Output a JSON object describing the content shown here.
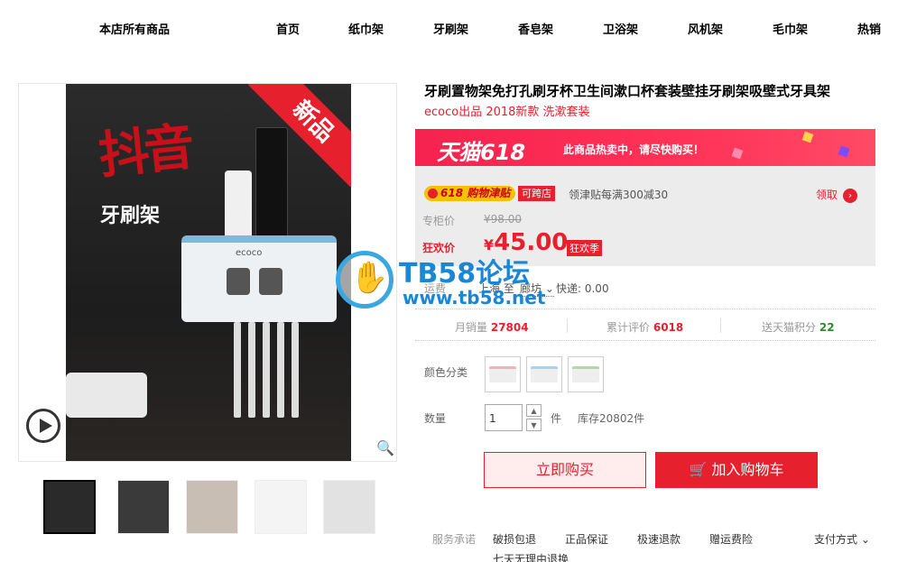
{
  "nav": {
    "store_all": "本店所有商品",
    "items": [
      "首页",
      "纸巾架",
      "牙刷架",
      "香皂架",
      "卫浴架",
      "风机架",
      "毛巾架",
      "热销"
    ]
  },
  "gallery": {
    "badge_new": "新品",
    "overlay_title": "抖音",
    "overlay_subtitle": "牙刷架",
    "holder_logo": "ecoco",
    "thumb_count": 5
  },
  "product": {
    "title": "牙刷置物架免打孔刷牙杯卫生间漱口杯套装壁挂牙刷架吸壁式牙具架",
    "subtitle": "ecoco出品 2018新款 洗漱套装"
  },
  "promo": {
    "banner_brand": "天猫618",
    "banner_text": "此商品热卖中，请尽快购买！",
    "coupon_tag": "618 购物津贴",
    "coupon_label": "可跨店",
    "coupon_desc": "领津贴每满300减30",
    "coupon_get": "领取"
  },
  "price": {
    "orig_label": "专柜价",
    "orig_value": "¥98.00",
    "sale_label": "狂欢价",
    "currency": "¥",
    "sale_value": "45.00",
    "sale_badge": "狂欢季"
  },
  "shipping": {
    "label": "运费",
    "from": "上海 至",
    "to": "廊坊",
    "fee": "快递: 0.00"
  },
  "stats": {
    "sales_label": "月销量",
    "sales_value": "27804",
    "reviews_label": "累计评价",
    "reviews_value": "6018",
    "points_label": "送天猫积分",
    "points_value": "22"
  },
  "options": {
    "color_label": "颜色分类",
    "swatch_colors": [
      "#e8b7b7",
      "#a9d3e6",
      "#b6d6a8"
    ],
    "qty_label": "数量",
    "qty_value": "1",
    "qty_unit": "件",
    "stock": "库存20802件"
  },
  "actions": {
    "buy_now": "立即购买",
    "add_cart": "加入购物车"
  },
  "service": {
    "label": "服务承诺",
    "items": [
      "破损包退",
      "正品保证",
      "极速退款",
      "赠运费险"
    ],
    "pay": "支付方式",
    "seven_day": "七天无理由退换"
  },
  "watermark": {
    "title": "TB58论坛",
    "url": "www.tb58.net"
  },
  "colors": {
    "accent": "#e6202d",
    "banner": "#ff3358",
    "points": "#2e8b2e"
  }
}
